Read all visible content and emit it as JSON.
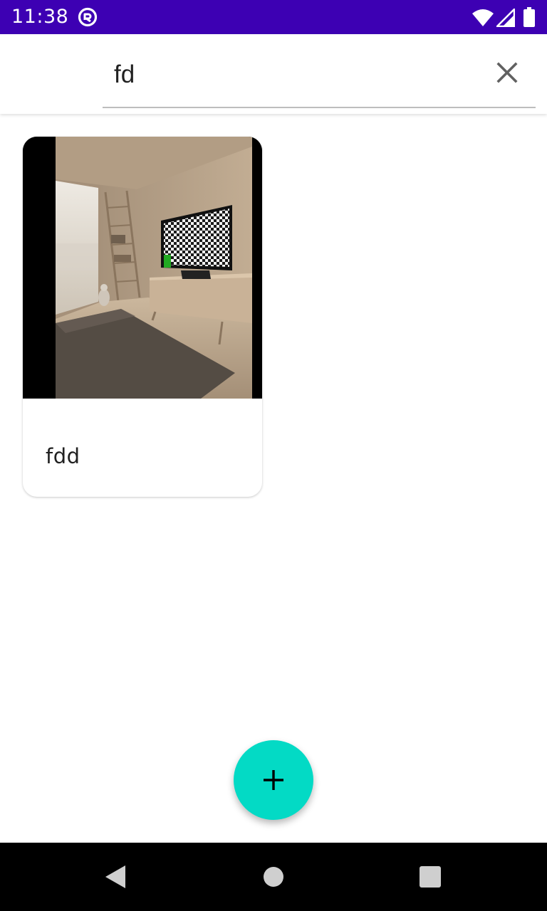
{
  "status_bar": {
    "time": "11:38",
    "background_color": "#3d00b3",
    "icons": [
      "app-notification-icon",
      "wifi-icon",
      "cell-signal-icon",
      "battery-icon"
    ]
  },
  "search": {
    "value": "fd",
    "clear_icon": "close-icon"
  },
  "results": [
    {
      "title": "fdd",
      "image": "living-room-photo"
    }
  ],
  "fab": {
    "icon": "plus-icon",
    "color": "#03dac5"
  },
  "navigation": {
    "icons": [
      "back-icon",
      "home-icon",
      "recents-icon"
    ]
  }
}
